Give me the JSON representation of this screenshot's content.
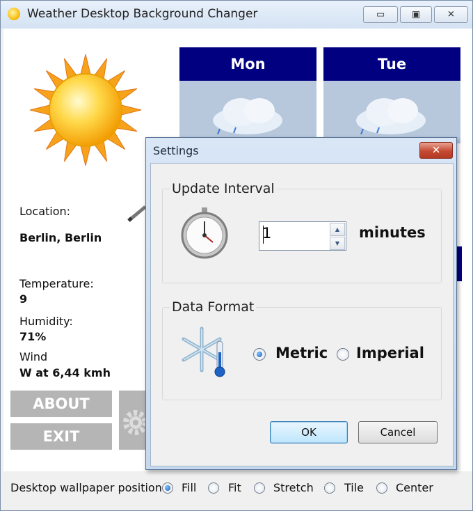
{
  "window": {
    "title": "Weather Desktop Background Changer"
  },
  "left_panel": {
    "location_label": "Location:",
    "location_value": "Berlin, Berlin",
    "temperature_label": "Temperature:",
    "temperature_value": "9",
    "humidity_label": "Humidity:",
    "humidity_value": "71%",
    "wind_label": "Wind",
    "wind_value": "W at 6,44 kmh",
    "about_button": "ABOUT",
    "exit_button": "EXIT"
  },
  "forecast": {
    "days": [
      "Mon",
      "Tue"
    ]
  },
  "wallpaper_position": {
    "label": "Desktop wallpaper position:",
    "options": [
      "Fill",
      "Fit",
      "Stretch",
      "Tile",
      "Center"
    ],
    "selected": "Fill"
  },
  "settings_dialog": {
    "title": "Settings",
    "update_interval": {
      "legend": "Update Interval",
      "value": "1",
      "unit": "minutes"
    },
    "data_format": {
      "legend": "Data Format",
      "options": [
        "Metric",
        "Imperial"
      ],
      "selected": "Metric"
    },
    "ok_button": "OK",
    "cancel_button": "Cancel"
  },
  "colors": {
    "day_header": "#000080",
    "button_gray": "#b5b5b5",
    "title_close_red": "#c54a32"
  }
}
